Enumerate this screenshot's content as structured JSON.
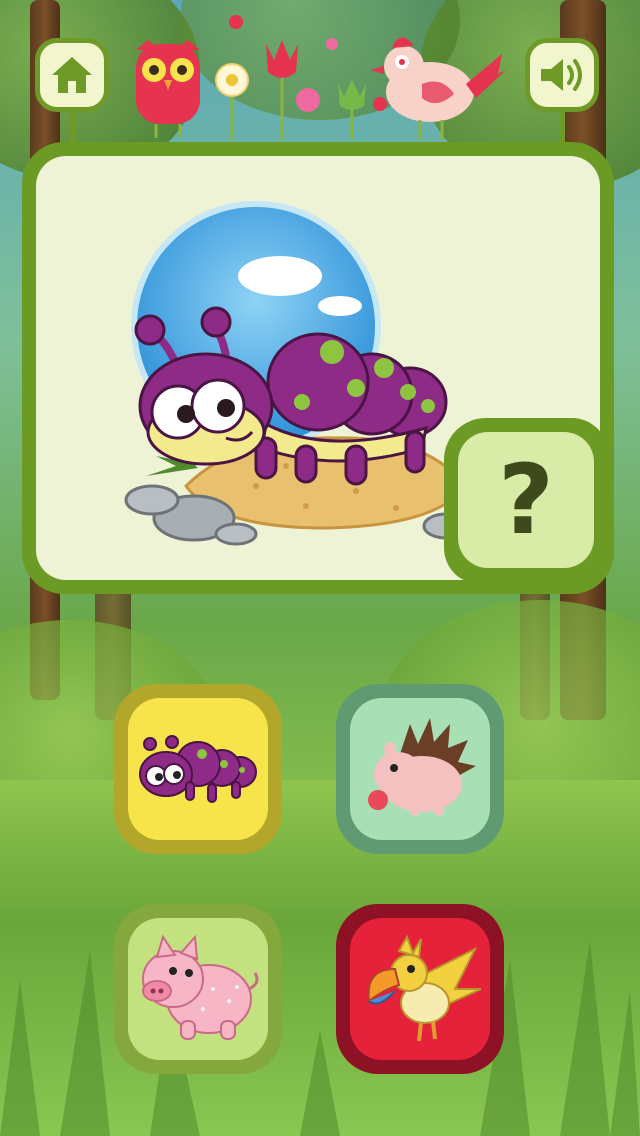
{
  "header": {
    "home_icon": "home-icon",
    "sound_icon": "speaker-icon"
  },
  "question": {
    "hint_label": "?",
    "pictured_animal": "caterpillar"
  },
  "choices": [
    {
      "animal": "caterpillar",
      "bg_color": "#f7e44a",
      "border_color": "#b2a72a"
    },
    {
      "animal": "hedgehog",
      "bg_color": "#a9dfb5",
      "border_color": "#5f9a73"
    },
    {
      "animal": "pig",
      "bg_color": "#c3e27f",
      "border_color": "#84a83d"
    },
    {
      "animal": "toucan",
      "bg_color": "#e5223a",
      "border_color": "#8e1225"
    }
  ],
  "colors": {
    "frame_green": "#6b9b25",
    "card_cream": "#eef3d6",
    "hint_green": "#d8eba7"
  }
}
